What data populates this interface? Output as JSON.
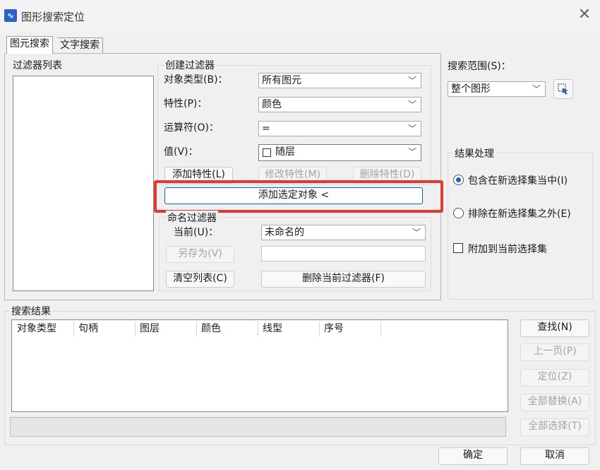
{
  "window": {
    "title": "图形搜索定位",
    "app_icon": "cad-app-icon",
    "close_glyph": "✕"
  },
  "tabs": [
    {
      "label": "图元搜索",
      "active": true
    },
    {
      "label": "文字搜索",
      "active": false
    }
  ],
  "filter_list": {
    "label": "过滤器列表"
  },
  "create_filter": {
    "legend": "创建过滤器",
    "object_type": {
      "label": "对象类型(B)：",
      "value": "所有图元"
    },
    "property": {
      "label": "特性(P)：",
      "value": "颜色"
    },
    "operator": {
      "label": "运算符(O)：",
      "value": "="
    },
    "value": {
      "label": "值(V)：",
      "value": "随层"
    },
    "add_property": "添加特性(L)",
    "modify_property": "修改特性(M)",
    "delete_property": "删除特性(D)",
    "add_selected": "添加选定对象 <"
  },
  "named_filter": {
    "legend": "命名过滤器",
    "current_label": "当前(U)：",
    "current_value": "未命名的",
    "save_as": "另存为(V)",
    "save_as_name": "",
    "clear_list": "清空列表(C)",
    "delete_current": "删除当前过滤器(F)"
  },
  "search_scope": {
    "label": "搜索范围(S)：",
    "value": "整个图形",
    "pick_icon": "select-objects-icon"
  },
  "result_handling": {
    "legend": "结果处理",
    "include_new": "包含在新选择集当中(I)",
    "exclude_new": "排除在新选择集之外(E)",
    "append_current": "附加到当前选择集",
    "selected_option": "include_new",
    "append_checked": false
  },
  "search_results": {
    "legend": "搜索结果",
    "columns": [
      "对象类型",
      "句柄",
      "图层",
      "颜色",
      "线型",
      "序号"
    ],
    "rows": [],
    "status_text": ""
  },
  "actions": {
    "find": "查找(N)",
    "prev_page": "上一页(P)",
    "locate": "定位(Z)",
    "replace_all": "全部替换(A)",
    "select_all": "全部选择(T)"
  },
  "footer": {
    "ok": "确定",
    "cancel": "取消"
  },
  "colors": {
    "highlight_border": "#e23a32",
    "accent": "#1f5fbf"
  }
}
